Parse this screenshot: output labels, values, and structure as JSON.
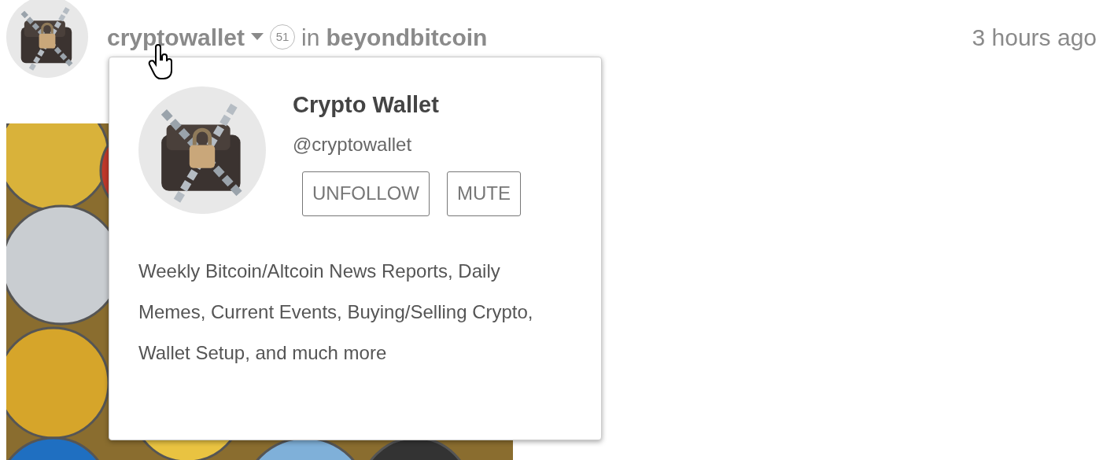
{
  "post": {
    "author": "cryptowallet",
    "reputation": "51",
    "in": "in",
    "community": "beyondbitcoin",
    "time": "3 hours ago"
  },
  "author_card": {
    "name": "Crypto Wallet",
    "handle": "@cryptowallet",
    "buttons": [
      "UNFOLLOW",
      "MUTE"
    ],
    "about": "Weekly Bitcoin/Altcoin News Reports, Daily Memes, Current Events, Buying/Selling Crypto, Wallet Setup, and much more"
  }
}
